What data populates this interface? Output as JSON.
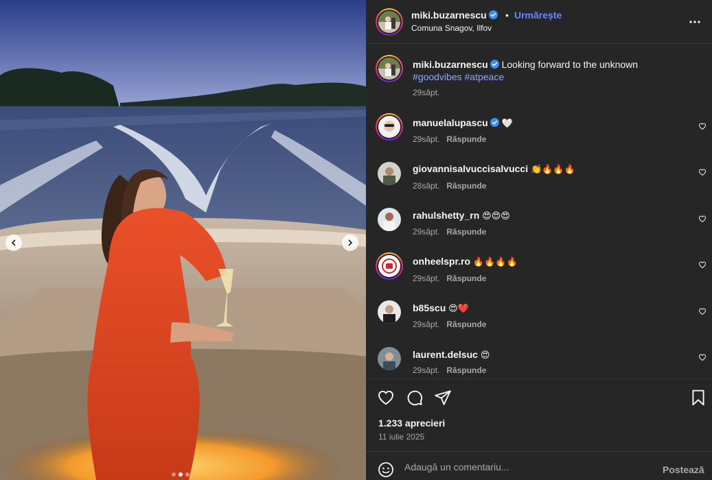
{
  "post": {
    "author": "miki.buzarnescu",
    "verified": true,
    "separator": "•",
    "follow_label": "Urmărește",
    "location": "Comuna Snagov, Ilfov",
    "more_icon": "more-horizontal-icon"
  },
  "caption": {
    "username": "miki.buzarnescu",
    "text": "Looking forward to the unknown",
    "hashtags": "#goodvibes #atpeace",
    "time": "29săpt."
  },
  "comments": [
    {
      "username": "manuelalupascu",
      "verified": true,
      "text": "🤍",
      "time": "29săpt.",
      "reply_label": "Răspunde",
      "story_ring": true
    },
    {
      "username": "giovannisalvuccisalvucci",
      "verified": false,
      "text": "👏🔥🔥🔥",
      "time": "28săpt.",
      "reply_label": "Răspunde",
      "story_ring": false
    },
    {
      "username": "rahulshetty_rn",
      "verified": false,
      "text": "😍😍😍",
      "time": "29săpt.",
      "reply_label": "Răspunde",
      "story_ring": false
    },
    {
      "username": "onheelspr.ro",
      "verified": false,
      "text": "🔥🔥🔥🔥",
      "time": "29săpt.",
      "reply_label": "Răspunde",
      "story_ring": true
    },
    {
      "username": "b85scu",
      "verified": false,
      "text": "😍❤️",
      "time": "29săpt.",
      "reply_label": "Răspunde",
      "story_ring": false
    },
    {
      "username": "laurent.delsuc",
      "verified": false,
      "text": "😍",
      "time": "29săpt.",
      "reply_label": "Răspunde",
      "story_ring": false
    }
  ],
  "stats": {
    "likes": "1.233 aprecieri",
    "date": "11 iulie 2025"
  },
  "composer": {
    "placeholder": "Adaugă un comentariu...",
    "post_label": "Postează"
  },
  "carousel": {
    "total_slides": 3,
    "active_slide": 2
  },
  "colors": {
    "panel_bg": "#262626",
    "accent_link": "#6b87ff",
    "hashtag": "#8fa8ff",
    "verified_badge": "#3a8ef0",
    "secondary_text": "#a8a8a8"
  }
}
